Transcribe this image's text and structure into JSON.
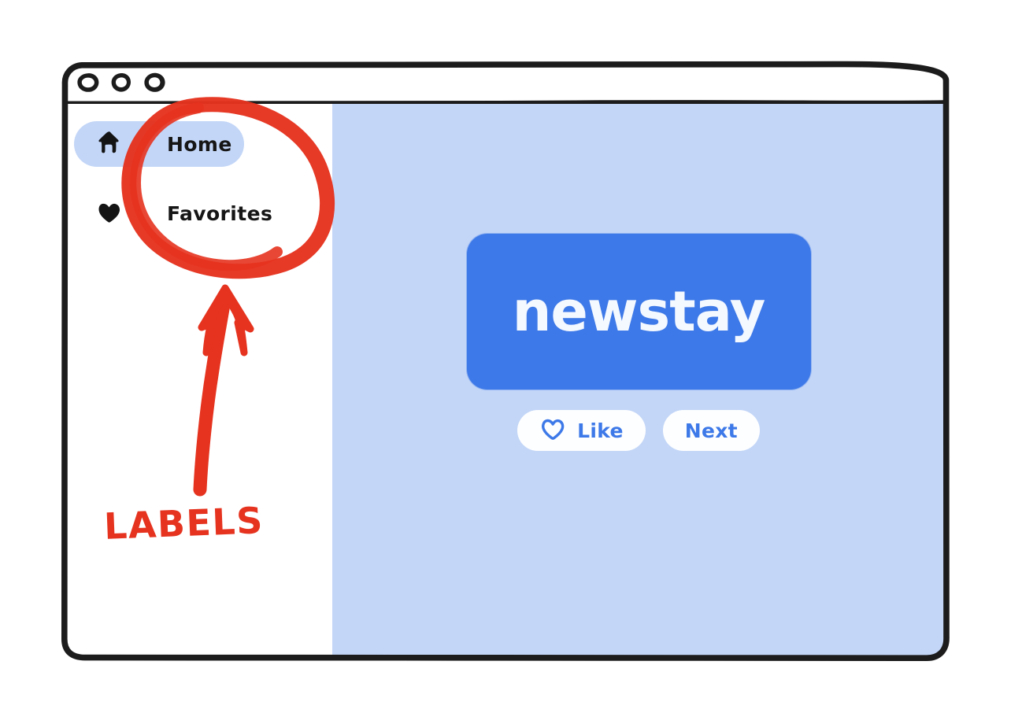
{
  "window": {
    "traffic_lights": [
      {
        "name": "close-dot"
      },
      {
        "name": "minimize-dot"
      },
      {
        "name": "maximize-dot"
      }
    ]
  },
  "sidebar": {
    "items": [
      {
        "id": "home",
        "label": "Home",
        "icon": "house-icon",
        "active": true
      },
      {
        "id": "favorites",
        "label": "Favorites",
        "icon": "heart-filled-icon",
        "active": false
      }
    ]
  },
  "main": {
    "hero": {
      "title": "newstay",
      "card_color": "#3d79e8",
      "title_color": "#f4f8ff"
    },
    "actions": [
      {
        "id": "like",
        "label": "Like",
        "icon": "heart-outline-icon",
        "has_icon": true
      },
      {
        "id": "next",
        "label": "Next",
        "icon": null,
        "has_icon": false
      }
    ],
    "background_color": "#c3d6f7"
  },
  "annotations": {
    "color": "#e5331f",
    "callout_text": "LABELS",
    "circle": {
      "name": "highlight-ellipse"
    },
    "arrow": {
      "name": "pointer-arrow-up"
    }
  }
}
